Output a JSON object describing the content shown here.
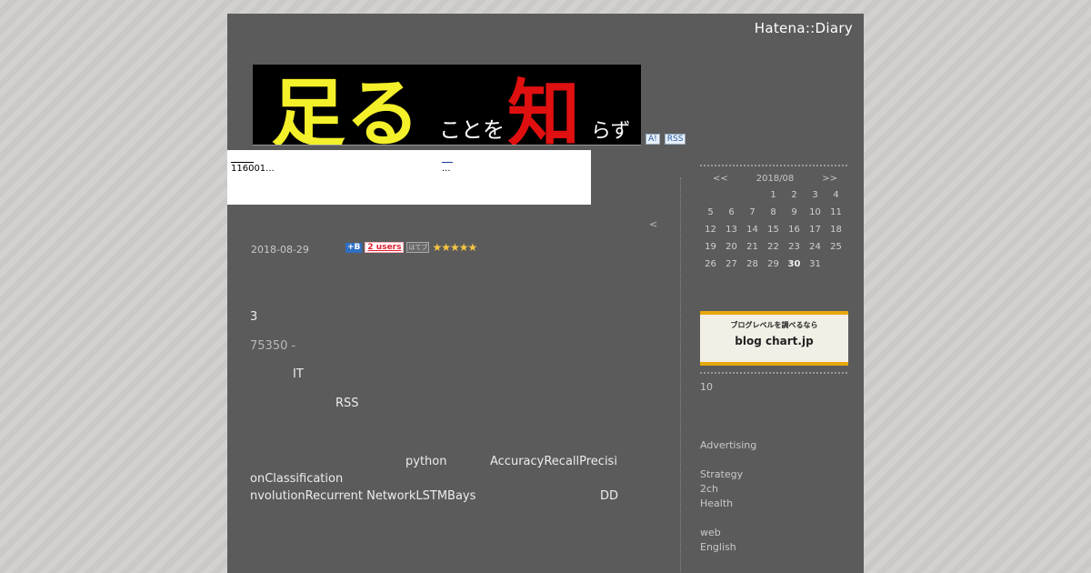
{
  "header": {
    "service_name": "Hatena::Diary",
    "banner_title_main": "足る",
    "banner_title_mid1": "ことを",
    "banner_title_kanji2": "知",
    "banner_title_end": "らず",
    "badge_antenna": "A!",
    "badge_rss": "RSS"
  },
  "ad": {
    "left_text": "116001...",
    "right_text": "..."
  },
  "nav": {
    "prev": "<"
  },
  "entry": {
    "date": "2018-08-29",
    "bookmark_b": "+B",
    "bookmark_users": "2 users",
    "bookmark_add": "はてブ",
    "stars": "★★★★★",
    "lines": {
      "l1": "3",
      "l2": "75350 -",
      "l3": "IT",
      "l4": "RSS",
      "l5a": "python",
      "l5b": "AccuracyRecallPrecisi",
      "l6": "onClassification",
      "l7a": "nvolutionRecurrent NetworkLSTMBays",
      "l7b": "DD"
    }
  },
  "calendar": {
    "prev": "<<",
    "month": "2018/08",
    "next": ">>",
    "weeks": [
      [
        "",
        "",
        "",
        "1",
        "2",
        "3",
        "4"
      ],
      [
        "5",
        "6",
        "7",
        "8",
        "9",
        "10",
        "11"
      ],
      [
        "12",
        "13",
        "14",
        "15",
        "16",
        "17",
        "18"
      ],
      [
        "19",
        "20",
        "21",
        "22",
        "23",
        "24",
        "25"
      ],
      [
        "26",
        "27",
        "28",
        "29",
        "30",
        "31",
        ""
      ]
    ],
    "bold_day": "30"
  },
  "sidebar": {
    "blogchart_caption": "ブログレベルを調べるなら",
    "blogchart_logo": "blog chart.jp",
    "count": "10",
    "categories": [
      "Advertising",
      "Strategy",
      "2ch",
      "Health",
      "web",
      "English"
    ]
  },
  "colors": {
    "page_bg": "#5b5b5b",
    "banner_yellow": "#f4f02a",
    "banner_red": "#e01010",
    "blogchart_border": "#e6a80d"
  }
}
